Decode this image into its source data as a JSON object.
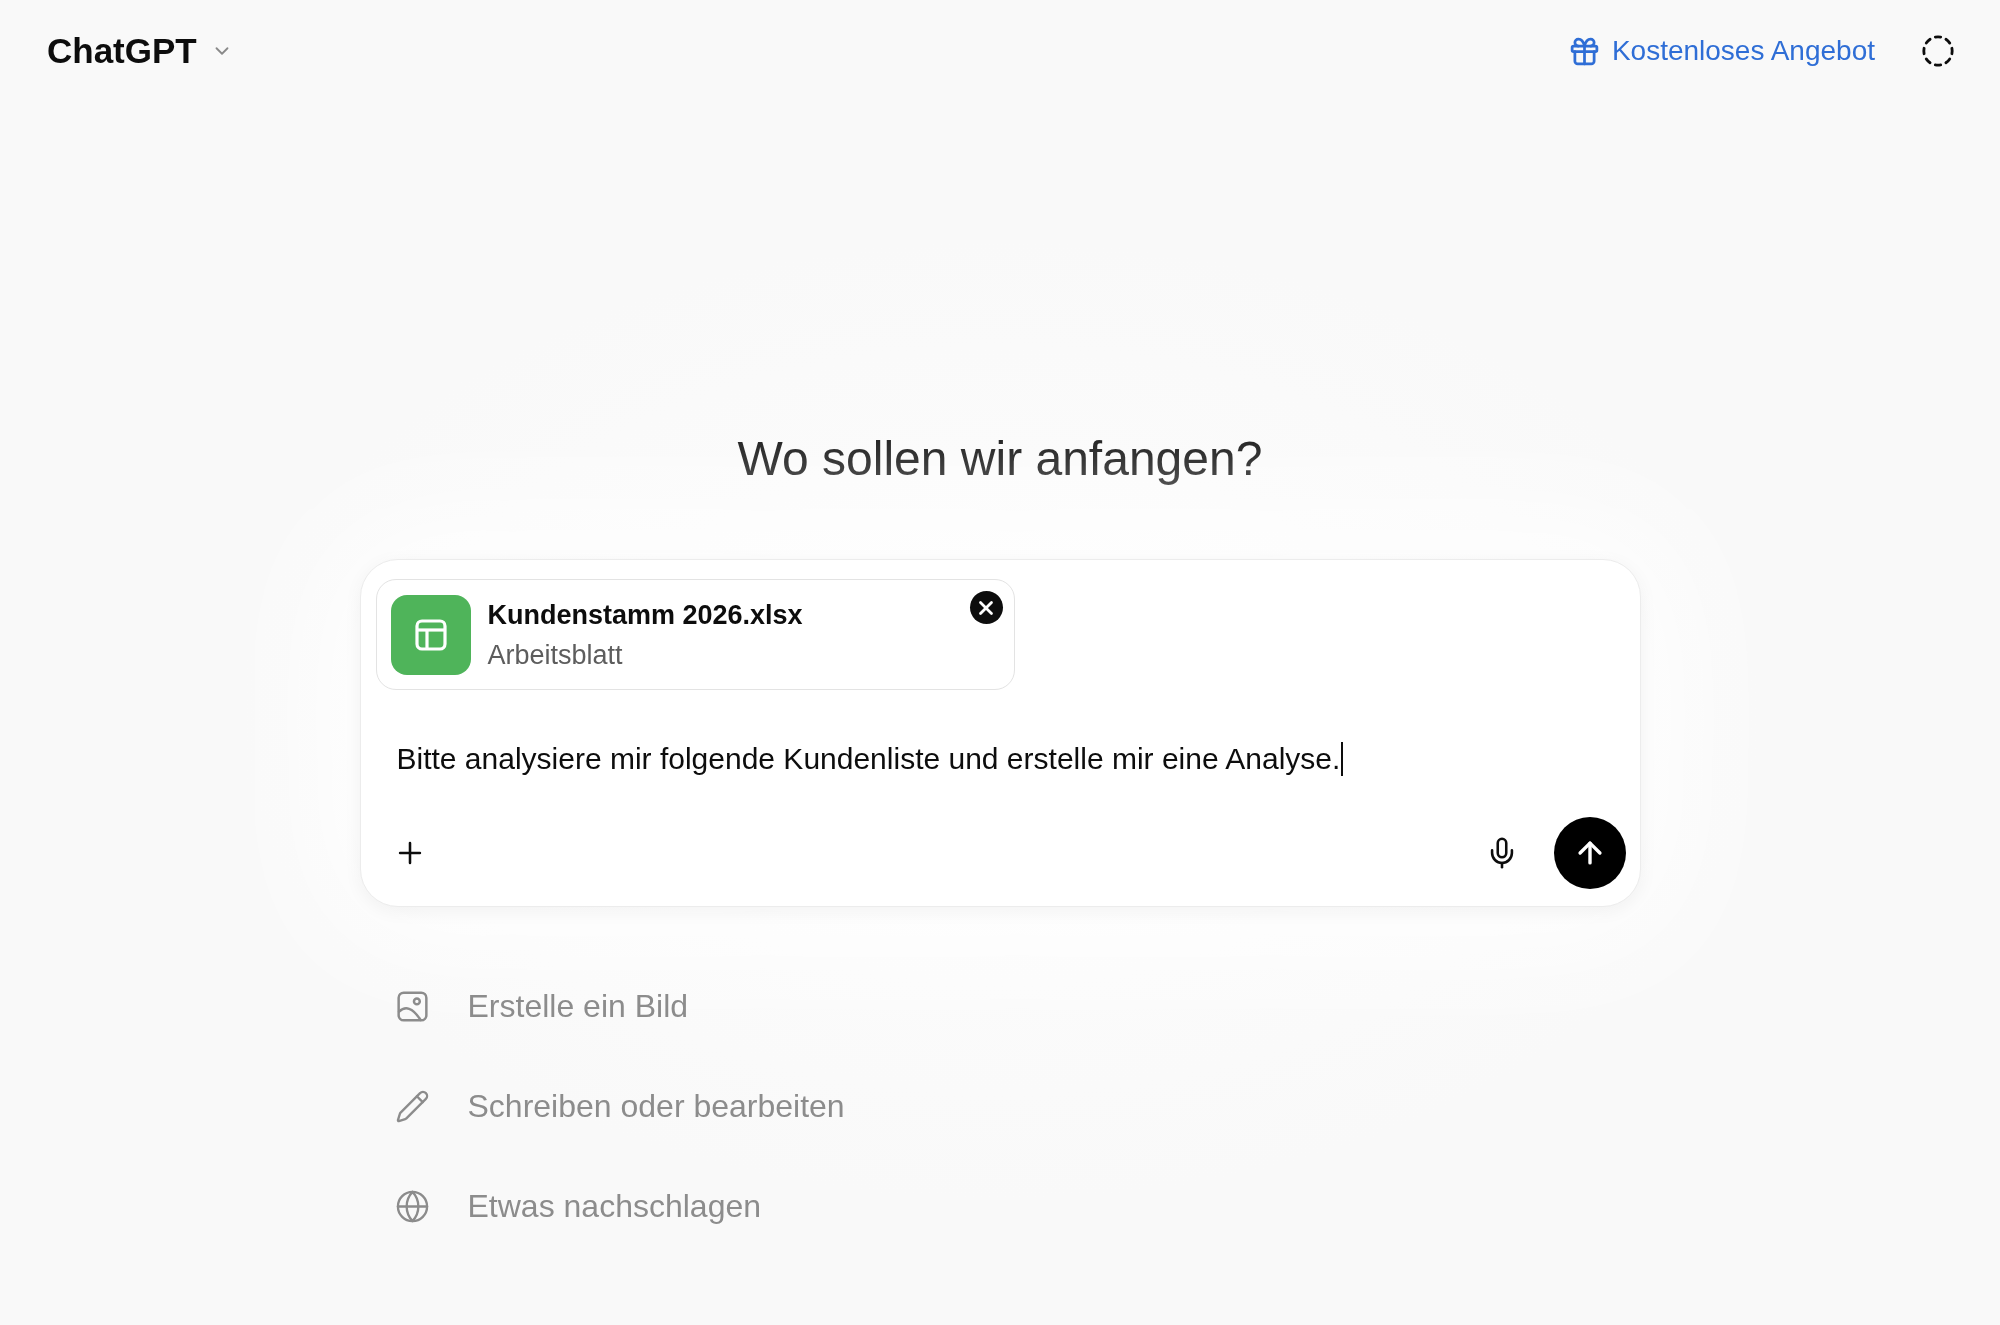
{
  "header": {
    "model_name": "ChatGPT",
    "offer_link": "Kostenloses Angebot"
  },
  "heading": "Wo sollen wir anfangen?",
  "composer": {
    "attachments": [
      {
        "kind": "spreadsheet",
        "name": "Kundenstamm 2026.xlsx",
        "type": "Arbeitsblatt"
      }
    ],
    "input": {
      "value": "Bitte analysiere mir folgende Kundenliste und erstelle mir eine Analyse.",
      "focused": true
    }
  },
  "suggestions": [
    {
      "kind": "image",
      "label": "Erstelle ein Bild"
    },
    {
      "kind": "write",
      "label": "Schreiben oder bearbeiten"
    },
    {
      "kind": "search",
      "label": "Etwas nachschlagen"
    }
  ]
}
